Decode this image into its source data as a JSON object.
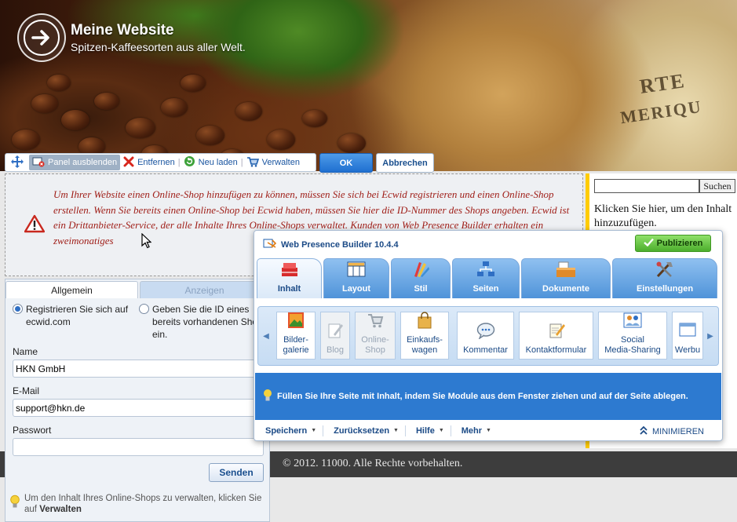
{
  "site": {
    "title": "Meine Website",
    "subtitle": "Spitzen-Kaffeesorten aus aller Welt."
  },
  "module_toolbar": {
    "hide_panel": "Panel ausblenden",
    "remove": "Entfernen",
    "reload": "Neu laden",
    "manage": "Verwalten",
    "ok": "OK",
    "cancel": "Abbrechen"
  },
  "warning_text": "Um Ihrer Website einen Online-Shop hinzufügen zu können, müssen Sie sich bei Ecwid registrieren und einen Online-Shop erstellen. Wenn Sie bereits einen Online-Shop bei Ecwid haben, müssen Sie hier die ID-Nummer des Shops angeben. Ecwid ist ein Drittanbieter-Service, der alle Inhalte Ihres Online-Shops verwaltet. Kunden von Web Presence Builder erhalten ein zweimonatiges",
  "sidebar": {
    "search_button": "Suchen",
    "search_value": "",
    "text": "Klicken Sie hier, um den Inhalt hinzuzufügen."
  },
  "footer": {
    "text": "© 2012. 11000. Alle Rechte vorbehalten."
  },
  "ecwid_panel": {
    "tabs": [
      "Allgemein",
      "Anzeigen"
    ],
    "radio_register": "Registrieren Sie sich auf ecwid.com",
    "radio_existing": "Geben Sie die ID eines bereits vorhandenen Shops ein.",
    "name_label": "Name",
    "name_value": "HKN GmbH",
    "email_label": "E-Mail",
    "email_value": "support@hkn.de",
    "password_label": "Passwort",
    "password_value": "",
    "send_button": "Senden",
    "hint_prefix": "Um den Inhalt Ihres Online-Shops zu verwalten, klicken Sie auf ",
    "hint_bold": "Verwalten"
  },
  "wpb": {
    "title": "Web Presence Builder 10.4.4",
    "publish": "Publizieren",
    "tabs": [
      "Inhalt",
      "Layout",
      "Stil",
      "Seiten",
      "Dokumente",
      "Einstellungen"
    ],
    "modules": [
      {
        "label": "Bilder-\ngalerie",
        "enabled": true
      },
      {
        "label": "Blog",
        "enabled": false
      },
      {
        "label": "Online-\nShop",
        "enabled": false
      },
      {
        "label": "Einkaufs-\nwagen",
        "enabled": true
      },
      {
        "label": "Kommentar",
        "enabled": true
      },
      {
        "label": "Kontaktformular",
        "enabled": true
      },
      {
        "label": "Social\nMedia-Sharing",
        "enabled": true
      },
      {
        "label": "Werbu",
        "enabled": true
      }
    ],
    "info": "Füllen Sie Ihre Seite mit Inhalt, indem Sie Module aus dem Fenster ziehen und auf der Seite ablegen.",
    "bottom": [
      "Speichern",
      "Zurücksetzen",
      "Hilfe",
      "Mehr"
    ],
    "minimize": "MINIMIEREN"
  },
  "colors": {
    "accent": "#2d7ad0",
    "warning": "#a0201a",
    "sidebar_border": "#ffcc00",
    "publish": "#4cae2c"
  }
}
